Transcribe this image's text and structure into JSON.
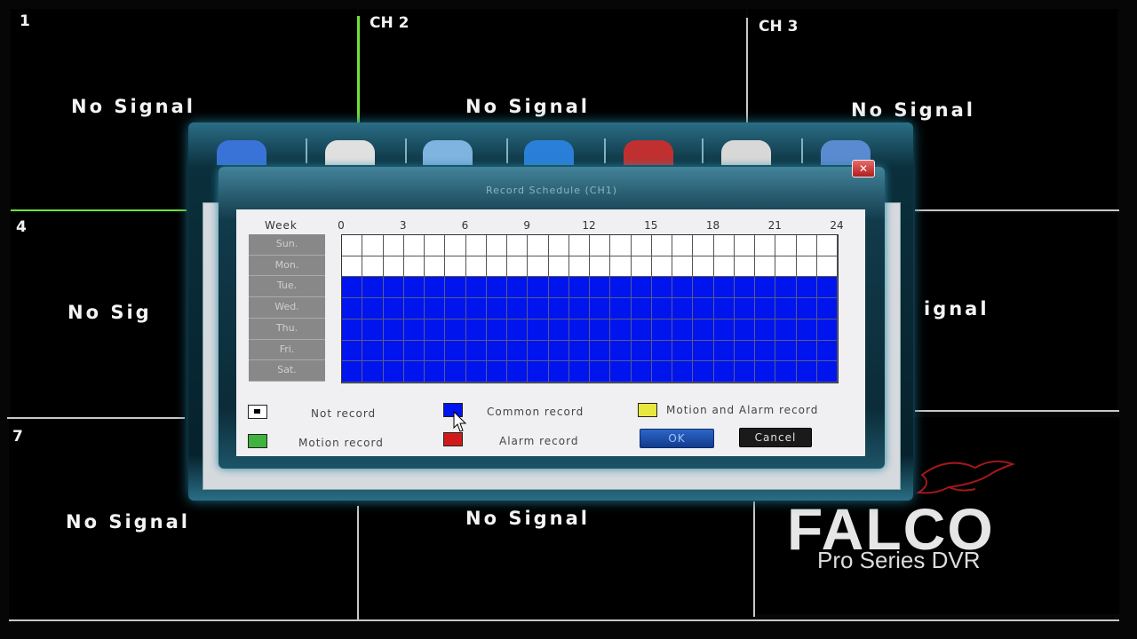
{
  "channels": {
    "ch1_label": "1",
    "ch2_label": "CH 2",
    "ch3_label": "CH 3",
    "ch4_label": "4",
    "ch7_label": "7",
    "no_signal_full": "No Signal",
    "no_signal_left_partial": "No Sig",
    "no_signal_right_partial": "ignal"
  },
  "dialog": {
    "title": "Record Schedule  (CH1)",
    "close_symbol": "✕",
    "week_label": "Week",
    "hour_ticks": [
      "0",
      "3",
      "6",
      "9",
      "12",
      "15",
      "18",
      "21",
      "24"
    ],
    "days": [
      "Sun.",
      "Mon.",
      "Tue.",
      "Wed.",
      "Thu.",
      "Fri.",
      "Sat."
    ],
    "schedule": {
      "Sun.": "not_record",
      "Mon.": "not_record",
      "Tue.": "common_record",
      "Wed.": "common_record",
      "Thu.": "common_record",
      "Fri.": "common_record",
      "Sat.": "common_record"
    },
    "legend": {
      "not_record": "Not record",
      "common_record": "Common record",
      "motion_alarm_record": "Motion and Alarm record",
      "motion_record": "Motion record",
      "alarm_record": "Alarm record"
    },
    "ok_label": "OK",
    "cancel_label": "Cancel"
  },
  "colors": {
    "common_record": "#0014ee",
    "not_record": "#ffffff",
    "motion_alarm_record": "#e8e840",
    "motion_record": "#3fb23f",
    "alarm_record": "#d01a1a",
    "ok_button": "#1b4fa8",
    "cancel_button": "#1a1a1a"
  },
  "logo": {
    "main": "FALCO",
    "sub": "Pro Series DVR"
  }
}
